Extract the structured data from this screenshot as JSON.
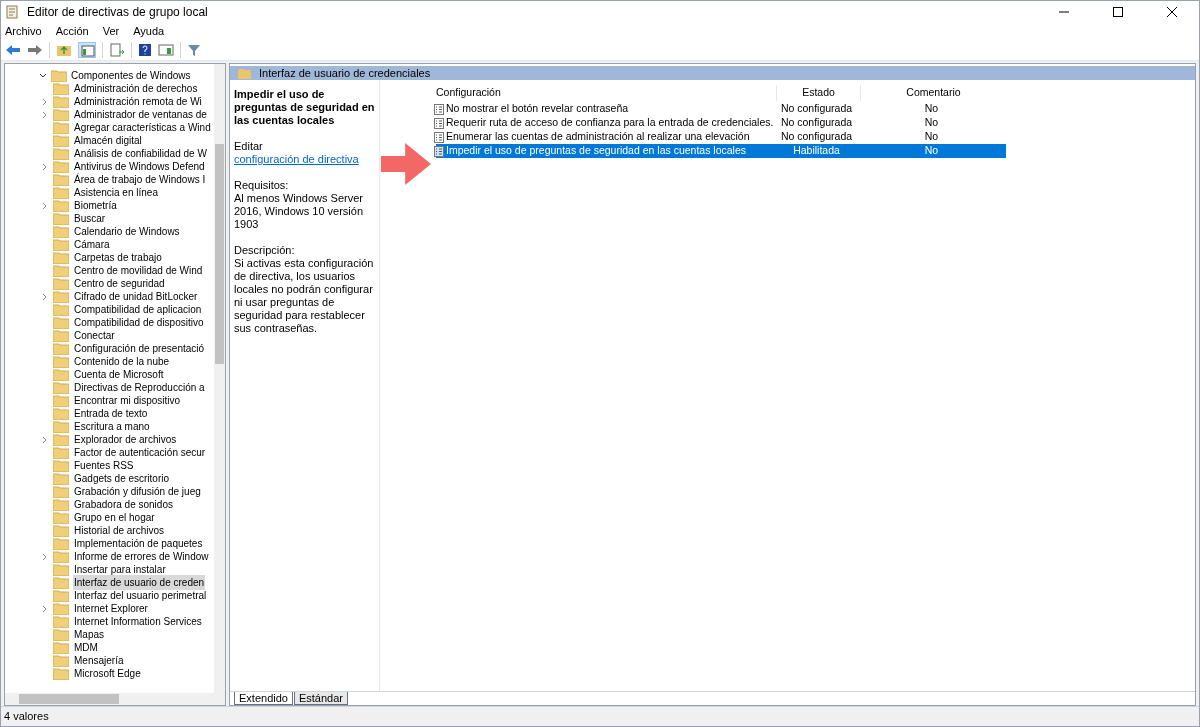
{
  "window": {
    "title": "Editor de directivas de grupo local"
  },
  "menu": [
    "Archivo",
    "Acción",
    "Ver",
    "Ayuda"
  ],
  "tree": {
    "root": {
      "label": "Componentes de Windows",
      "expanded": true
    },
    "children": [
      {
        "label": "Administración de derechos",
        "expandable": false,
        "selected": false
      },
      {
        "label": "Administración remota de Wi",
        "expandable": true,
        "selected": false
      },
      {
        "label": "Administrador de ventanas de",
        "expandable": true,
        "selected": false
      },
      {
        "label": "Agregar características a Wind",
        "expandable": false,
        "selected": false
      },
      {
        "label": "Almacén digital",
        "expandable": false,
        "selected": false
      },
      {
        "label": "Análisis de confiabilidad de W",
        "expandable": false,
        "selected": false
      },
      {
        "label": "Antivirus de Windows Defend",
        "expandable": true,
        "selected": false
      },
      {
        "label": "Área de trabajo de Windows I",
        "expandable": false,
        "selected": false
      },
      {
        "label": "Asistencia en línea",
        "expandable": false,
        "selected": false
      },
      {
        "label": "Biometría",
        "expandable": true,
        "selected": false
      },
      {
        "label": "Buscar",
        "expandable": false,
        "selected": false
      },
      {
        "label": "Calendario de Windows",
        "expandable": false,
        "selected": false
      },
      {
        "label": "Cámara",
        "expandable": false,
        "selected": false
      },
      {
        "label": "Carpetas de trabajo",
        "expandable": false,
        "selected": false
      },
      {
        "label": "Centro de movilidad de Wind",
        "expandable": false,
        "selected": false
      },
      {
        "label": "Centro de seguridad",
        "expandable": false,
        "selected": false
      },
      {
        "label": "Cifrado de unidad BitLocker",
        "expandable": true,
        "selected": false
      },
      {
        "label": "Compatibilidad de aplicacion",
        "expandable": false,
        "selected": false
      },
      {
        "label": "Compatibilidad de dispositivo",
        "expandable": false,
        "selected": false
      },
      {
        "label": "Conectar",
        "expandable": false,
        "selected": false
      },
      {
        "label": "Configuración de presentació",
        "expandable": false,
        "selected": false
      },
      {
        "label": "Contenido de la nube",
        "expandable": false,
        "selected": false
      },
      {
        "label": "Cuenta de Microsoft",
        "expandable": false,
        "selected": false
      },
      {
        "label": "Directivas de Reproducción a",
        "expandable": false,
        "selected": false
      },
      {
        "label": "Encontrar mi dispositivo",
        "expandable": false,
        "selected": false
      },
      {
        "label": "Entrada de texto",
        "expandable": false,
        "selected": false
      },
      {
        "label": "Escritura a mano",
        "expandable": false,
        "selected": false
      },
      {
        "label": "Explorador de archivos",
        "expandable": true,
        "selected": false
      },
      {
        "label": "Factor de autenticación secur",
        "expandable": false,
        "selected": false
      },
      {
        "label": "Fuentes RSS",
        "expandable": false,
        "selected": false
      },
      {
        "label": "Gadgets de escritorio",
        "expandable": false,
        "selected": false
      },
      {
        "label": "Grabación y difusión de jueg",
        "expandable": false,
        "selected": false
      },
      {
        "label": "Grabadora de sonidos",
        "expandable": false,
        "selected": false
      },
      {
        "label": "Grupo en el hogar",
        "expandable": false,
        "selected": false
      },
      {
        "label": "Historial de archivos",
        "expandable": false,
        "selected": false
      },
      {
        "label": "Implementación de paquetes",
        "expandable": false,
        "selected": false
      },
      {
        "label": "Informe de errores de Window",
        "expandable": true,
        "selected": false
      },
      {
        "label": "Insertar para instalar",
        "expandable": false,
        "selected": false
      },
      {
        "label": "Interfaz de usuario de creden",
        "expandable": false,
        "selected": true
      },
      {
        "label": "Interfaz del usuario perimetral",
        "expandable": false,
        "selected": false
      },
      {
        "label": "Internet Explorer",
        "expandable": true,
        "selected": false
      },
      {
        "label": "Internet Information Services",
        "expandable": false,
        "selected": false
      },
      {
        "label": "Mapas",
        "expandable": false,
        "selected": false
      },
      {
        "label": "MDM",
        "expandable": false,
        "selected": false
      },
      {
        "label": "Mensajería",
        "expandable": false,
        "selected": false
      },
      {
        "label": "Microsoft Edge",
        "expandable": false,
        "selected": false
      }
    ]
  },
  "details": {
    "header": "Interfaz de usuario de credenciales",
    "title": "Impedir el uso de preguntas de seguridad en las cuentas locales",
    "edit_prefix": "Editar",
    "edit_link": "configuración de directiva",
    "requirements_label": "Requisitos:",
    "requirements": "Al menos Windows Server 2016, Windows 10 versión 1903",
    "description_label": "Descripción:",
    "description": "Si activas esta configuración de directiva, los usuarios locales no podrán configurar ni usar preguntas de seguridad para restablecer sus contraseñas."
  },
  "table": {
    "columns": [
      "Configuración",
      "Estado",
      "Comentario"
    ],
    "rows": [
      {
        "setting": "No mostrar el botón revelar contraseña",
        "state": "No configurada",
        "comment": "No",
        "selected": false
      },
      {
        "setting": "Requerir ruta de acceso de confianza para la entrada de credenciales.",
        "state": "No configurada",
        "comment": "No",
        "selected": false
      },
      {
        "setting": "Enumerar las cuentas de administración al realizar una elevación",
        "state": "No configurada",
        "comment": "No",
        "selected": false
      },
      {
        "setting": "Impedir el uso de preguntas de seguridad en las cuentas locales",
        "state": "Habilitada",
        "comment": "No",
        "selected": true
      }
    ]
  },
  "tabs": [
    {
      "label": "Extendido",
      "selected": true
    },
    {
      "label": "Estándar",
      "selected": false
    }
  ],
  "status_bar": "4 valores"
}
